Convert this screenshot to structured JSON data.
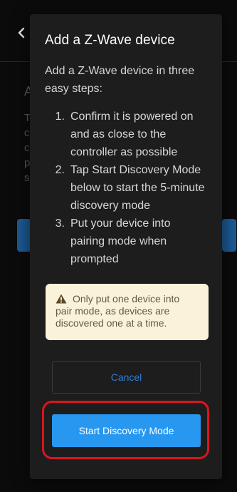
{
  "dialog": {
    "title": "Add a Z-Wave device",
    "intro": "Add a Z-Wave device in three easy steps:",
    "steps": [
      {
        "number": "1.",
        "text": "Confirm it is powered on and as close to the controller as possible"
      },
      {
        "number": "2.",
        "text": "Tap Start Discovery Mode below to start the 5-minute discovery mode"
      },
      {
        "number": "3.",
        "text": "Put your device into pairing mode when prompted"
      }
    ],
    "warning": {
      "icon": "warning-triangle-icon",
      "text": "Only put one device into pair mode, as devices are discovered one at a time."
    },
    "cancel_label": "Cancel",
    "start_label": "Start Discovery Mode"
  },
  "background": {
    "back_icon": "chevron-left-icon",
    "partial_glyphs": [
      "A",
      "T",
      "c",
      "c",
      "p",
      "s"
    ]
  },
  "colors": {
    "accent": "#2797f0",
    "cancel_text": "#2f7fd6",
    "highlight_ring": "#d9161f",
    "warning_bg": "#fbf3d9"
  }
}
